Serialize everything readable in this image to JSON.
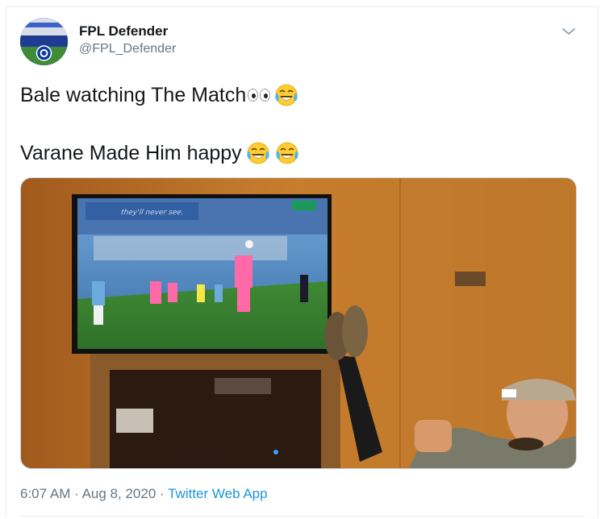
{
  "tweet": {
    "author": {
      "display_name": "FPL Defender",
      "handle": "@FPL_Defender",
      "avatar_icon": "club-crest-avatar"
    },
    "text_line_1": "Bale watching The Match",
    "text_line_2": "Varane Made Him happy",
    "emoji": {
      "eyes": "eyes-emoji",
      "laugh": "face-with-tears-of-joy-emoji"
    },
    "media": {
      "kind": "photo",
      "tv_overlay_text": "they'll never see."
    },
    "time": "6:07 AM",
    "separator": "·",
    "date": "Aug 8, 2020",
    "source": "Twitter Web App"
  },
  "colors": {
    "text_primary": "#14171a",
    "text_secondary": "#657786",
    "link": "#1b95e0",
    "border": "#e6ecf0"
  },
  "icons": {
    "caret": "chevron-down-icon"
  }
}
